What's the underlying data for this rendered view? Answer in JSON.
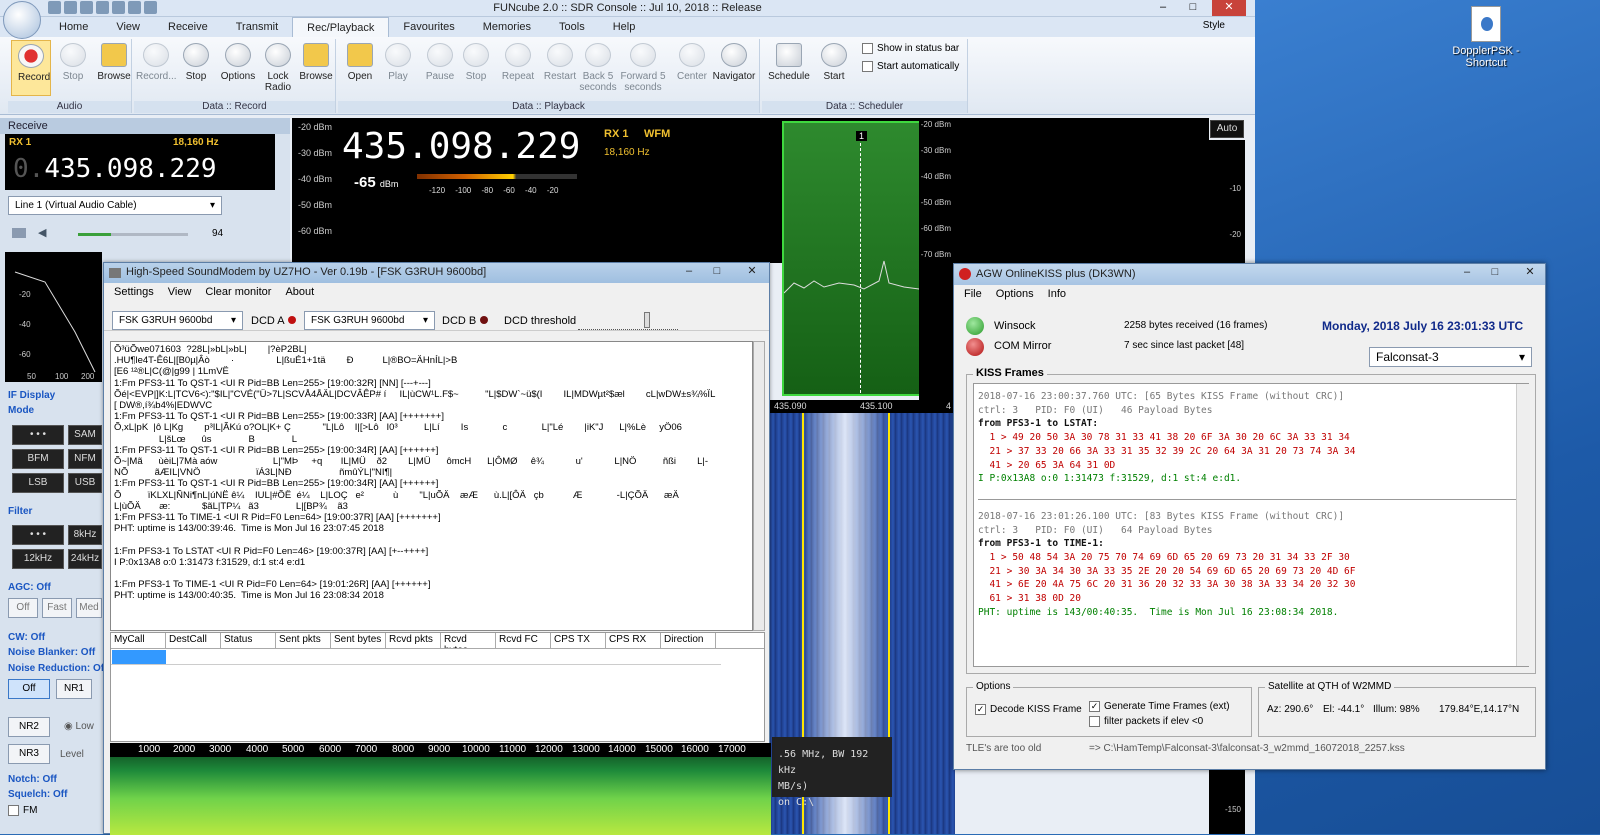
{
  "fc": {
    "title": "FUNcube 2.0 :: SDR Console :: Jul 10, 2018 :: Release",
    "style": "Style",
    "tabs": [
      "Home",
      "View",
      "Receive",
      "Transmit",
      "Rec/Playback",
      "Favourites",
      "Memories",
      "Tools",
      "Help"
    ],
    "ribbon": {
      "record": "Record",
      "stop": "Stop",
      "browse": "Browse",
      "record2": "Record...",
      "stop2": "Stop",
      "options": "Options",
      "lock": "Lock Radio",
      "browse2": "Browse",
      "open": "Open",
      "play": "Play",
      "pause": "Pause",
      "stop3": "Stop",
      "repeat": "Repeat",
      "restart": "Restart",
      "back5": "Back 5 seconds",
      "fwd5": "Forward 5 seconds",
      "center": "Center",
      "navigator": "Navigator",
      "schedule": "Schedule",
      "start": "Start",
      "show_status": "Show in status bar",
      "start_auto": "Start automatically"
    },
    "groups": {
      "audio": "Audio",
      "record": "Data :: Record",
      "playback": "Data :: Playback",
      "scheduler": "Data :: Scheduler"
    },
    "receive": {
      "header": "Receive",
      "rx": "RX 1",
      "hz": "18,160 Hz",
      "freq": "435.098.229",
      "freq_prefix": "0.",
      "line": "Line 1 (Virtual Audio Cable)",
      "vol": "94"
    },
    "display": {
      "freq": "435.098.229",
      "rx": "RX 1",
      "mode": "WFM",
      "hz": "18,160 Hz",
      "level": "-65",
      "unit": "dBm",
      "ticks": "-120 -100 -80 -60 -40 -20",
      "auto": "Auto",
      "mk": "1",
      "f1": "435.090",
      "f2": "435.100",
      "f3": "4"
    },
    "db_left": [
      "-20 dBm",
      "-30 dBm",
      "-40 dBm",
      "-50 dBm",
      "-60 dBm"
    ],
    "db_right": [
      "-20 dBm",
      "-30 dBm",
      "-40 dBm",
      "-50 dBm",
      "-60 dBm",
      "-70 dBm"
    ],
    "rcol": [
      "-10",
      "-20",
      "-150"
    ],
    "lpspec": [
      "-20",
      "-40",
      "-60",
      "50",
      "100",
      "200"
    ],
    "side": {
      "if": "IF Display",
      "mode": "Mode",
      "bfm": "BFM",
      "nfm": "NFM",
      "lsb": "LSB",
      "usb": "USB",
      "sam": "SAM",
      "filter": "Filter",
      "k8": "8kHz",
      "k12": "12kHz",
      "k24": "24kHz",
      "dots": "• • •",
      "agc": "AGC: Off",
      "off": "Off",
      "fast": "Fast",
      "med": "Med",
      "cw": "CW: Off",
      "nb": "Noise Blanker: Off",
      "nr": "Noise Reduction: Off",
      "nr1": "NR1",
      "nr2": "NR2",
      "nr3": "NR3",
      "low": "Low",
      "level": "Level",
      "notch": "Notch: Off",
      "squelch": "Squelch: Off",
      "fm": "FM"
    },
    "info": [
      ".56 MHz, BW 192 kHz",
      "MB/s)",
      "on C:\\"
    ]
  },
  "sm": {
    "title": "High-Speed SoundModem by UZ7HO - Ver 0.19b - [FSK G3RUH 9600bd]",
    "menu": [
      "Settings",
      "View",
      "Clear monitor",
      "About"
    ],
    "modemA": "FSK G3RUH 9600bd",
    "dcdA": "DCD A",
    "modemB": "FSK G3RUH 9600bd",
    "dcdB": "DCD B",
    "thr": "DCD threshold",
    "log": "Õ³üÕwe071603  ?28L|»bL|»bL|        |?èP2BL|\n.HU¶le4T-Ê6L|[B0µ|Âò        ·                L|ßuÉ1+1tä        Ð           L|®BO=ÄHnÍL|>B\n[E6 ¹²®L|C(@|g99 | 1LmVË\n1:Fm PFS3-11 To QST-1 <UI R Pid=BB Len=255> [19:00:32R] [NN] [---+---]\nÕé|<EVP|]K:L|TCV6<):\"$IL|\"CVÉ(\"Ü>7L|SCVÅ4ÅÄL|DCVÂÊP# í     IL|ùCW¹L.F$~          \"L|$DW`~ü$(I        IL|MDWµt²$æl        cL|wDW±s¾%ÏL\n[ DW®,í¾b4%|EDWVC\n1:Fm PFS3-11 To QST-1 <UI R Pid=BB Len=255> [19:00:33R] [AA] [+++++++]\nÕ,xL|pK  |ô L|Kg        p³IL|ÃKú o?OL|K+ Ç            \"L|Lô    I|[>Lô   I0³          L|Lí        Is             c             L|\"Lé        |iK\"J      L|%Lè     yÖ06\n                 L|šLœ      ûs              B              L\n1:Fm PFS3-11 To QST-1 <UI R Pid=BB Len=255> [19:00:34R] [AA] [++++++]\nÕ~|Mã      ùèiL|7Mà aów                     L|\"MÞ     +q       IL|MÜ    ð2        L|MÜ      ômcH      L|ÔMØ     ê¾            u'            L|NÖ          ñßi        L|-\nNÕ          ãÆIL|VNÖ                     ïÁ3L|NÐ                  ñmûÝL|\"NI¶|\n1:Fm PFS3-11 To QST-1 <UI R Pid=BB Len=255> [19:00:34R] [AA] [++++++]\nÕ          ïKLXL|ÑNi¶nL|úNË ê¼    IUL|#ÕË  é¼    L|LOÇ   e²           ù        \"L|uÕÄ    æÆ      ù.L|[ÔÄ   çb           Æ             -L|ÇÕÄ      æÄ\nL|ùÕÄ       æ:            $ãL|TP¼   ã3              L|[BP¾    ã3\n1:Fm PFS3-11 To TIME-1 <UI R Pid=F0 Len=64> [19:00:37R] [AA] [+++++++]\nPHT: uptime is 143/00:39:46.  Time is Mon Jul 16 23:07:45 2018\n\n1:Fm PFS3-1 To LSTAT <UI R Pid=F0 Len=46> [19:00:37R] [AA] [+--++++]\nI P:0x13A8 o:0 1:31473 f:31529, d:1 st:4 e:d1\n\n1:Fm PFS3-1 To TIME-1 <UI R Pid=F0 Len=64> [19:01:26R] [AA] [++++++]\nPHT: uptime is 143/00:40:35.  Time is Mon Jul 16 23:08:34 2018",
    "cols": [
      "MyCall",
      "DestCall",
      "Status",
      "Sent pkts",
      "Sent bytes",
      "Rcvd pkts",
      "Rcvd bytes",
      "Rcvd FC",
      "CPS TX",
      "CPS RX",
      "Direction"
    ],
    "axis": [
      "1000",
      "2000",
      "3000",
      "4000",
      "5000",
      "6000",
      "7000",
      "8000",
      "9000",
      "10000",
      "11000",
      "12000",
      "13000",
      "14000",
      "15000",
      "16000",
      "17000"
    ]
  },
  "agw": {
    "title": "AGW OnlineKISS plus (DK3WN)",
    "menu": [
      "File",
      "Options",
      "Info"
    ],
    "winsock": "Winsock",
    "bytes": "2258 bytes received (16 frames)",
    "date": "Monday, 2018 July 16  23:01:33 UTC",
    "com": "COM Mirror",
    "since": "7 sec since last packet [48]",
    "sat": "Falconsat-3",
    "kiss": "KISS Frames",
    "k": [
      "2018-07-16 23:00:37.760 UTC: [65 Bytes KISS Frame (without CRC)]",
      "ctrl: 3   PID: F0 (UI)   46 Payload Bytes",
      "from PFS3-1 to LSTAT:",
      "  1 > 49 20 50 3A 30 78 31 33 41 38 20 6F 3A 30 20 6C 3A 33 31 34",
      "  21 > 37 33 20 66 3A 33 31 35 32 39 2C 20 64 3A 31 20 73 74 3A 34",
      "  41 > 20 65 3A 64 31 0D",
      "I P:0x13A8 o:0 1:31473 f:31529, d:1 st:4 e:d1.",
      "2018-07-16 23:01:26.100 UTC: [83 Bytes KISS Frame (without CRC)]",
      "ctrl: 3   PID: F0 (UI)   64 Payload Bytes",
      "from PFS3-1 to TIME-1:",
      "  1 > 50 48 54 3A 20 75 70 74 69 6D 65 20 69 73 20 31 34 33 2F 30",
      "  21 > 30 3A 34 30 3A 33 35 2E 20 20 54 69 6D 65 20 69 73 20 4D 6F",
      "  41 > 6E 20 4A 75 6C 20 31 36 20 32 33 3A 30 38 3A 33 34 20 32 30",
      "  61 > 31 38 0D 20",
      "PHT: uptime is 143/00:40:35.  Time is Mon Jul 16 23:08:34 2018."
    ],
    "options": "Options",
    "decode": "Decode KISS Frame",
    "gen": "Generate Time Frames (ext)",
    "filter": "filter packets if elev <0",
    "satqth": "Satellite at QTH of W2MMD",
    "az": "Az: 290.6°",
    "el": "El: -44.1°",
    "illum": "Illum: 98%",
    "pos": "179.84°E,14.17°N",
    "tle": "TLE's are too old",
    "path": "=> C:\\HamTemp\\Falconsat-3\\falconsat-3_w2mmd_16072018_2257.kss"
  },
  "desktop": {
    "icon": "DopplerPSK - Shortcut"
  }
}
